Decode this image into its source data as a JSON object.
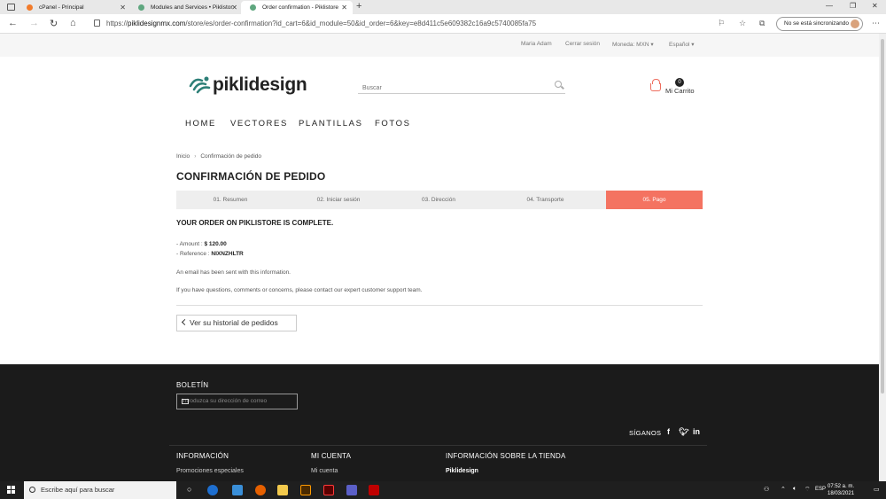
{
  "browser": {
    "tabs": [
      {
        "label": "cPanel - Principal",
        "color": "#f27b2a"
      },
      {
        "label": "Modules and Services • Piklistor",
        "color": "#5fa77f"
      },
      {
        "label": "Order confirmation - Piklistore",
        "color": "#5fa77f"
      }
    ],
    "url_prefix": "https://",
    "url_domain": "piklidesignmx.com",
    "url_path": "/store/es/order-confirmation?id_cart=6&id_module=50&id_order=6&key=e8d411c5e609382c16a9c5740085fa75",
    "sync_label": "No se está sincronizando"
  },
  "topbar": {
    "user": "Maria Adam",
    "logout": "Cerrar sesión",
    "currency": "Moneda: MXN",
    "language": "Español"
  },
  "header": {
    "logo_text": "piklidesign",
    "search_placeholder": "Buscar",
    "cart_label": "Mi Carrito",
    "cart_count": "0"
  },
  "mainnav": [
    "HOME",
    "VECTORES",
    "PLANTILLAS",
    "FOTOS"
  ],
  "breadcrumb": [
    "Inicio",
    "Confirmación de pedido"
  ],
  "page": {
    "title": "CONFIRMACIÓN DE PEDIDO",
    "steps": [
      "01. Resumen",
      "02. Iniciar sesión",
      "03. Dirección",
      "04. Transporte",
      "05. Pago"
    ],
    "active_step": 4,
    "complete_msg": "YOUR ORDER ON PIKLISTORE IS COMPLETE.",
    "amount_label": "- Amount :",
    "amount_value": "$ 120.00",
    "reference_label": "- Reference :",
    "reference_value": "NIXNZHLTR",
    "email_note": "An email has been sent with this information.",
    "support_note": "If you have questions, comments or concerns, please contact our expert customer support team.",
    "history_button": "Ver su historial de pedidos"
  },
  "footer": {
    "newsletter": "BOLETÍN",
    "newsletter_placeholder": "Introduzca su dirección de correo",
    "follow": "SÍGANOS",
    "columns": [
      {
        "title": "INFORMACIÓN",
        "first": "Promociones especiales"
      },
      {
        "title": "MI CUENTA",
        "first": "Mi cuenta"
      },
      {
        "title": "INFORMACIÓN SOBRE LA TIENDA",
        "first": "Piklidesign"
      }
    ]
  },
  "taskbar": {
    "search": "Escribe aquí para buscar",
    "lang": "ESP",
    "time": "07:52 a. m.",
    "date": "18/03/2021"
  },
  "colors": {
    "accent": "#f47361",
    "footer_bg": "#1b1b1b"
  }
}
